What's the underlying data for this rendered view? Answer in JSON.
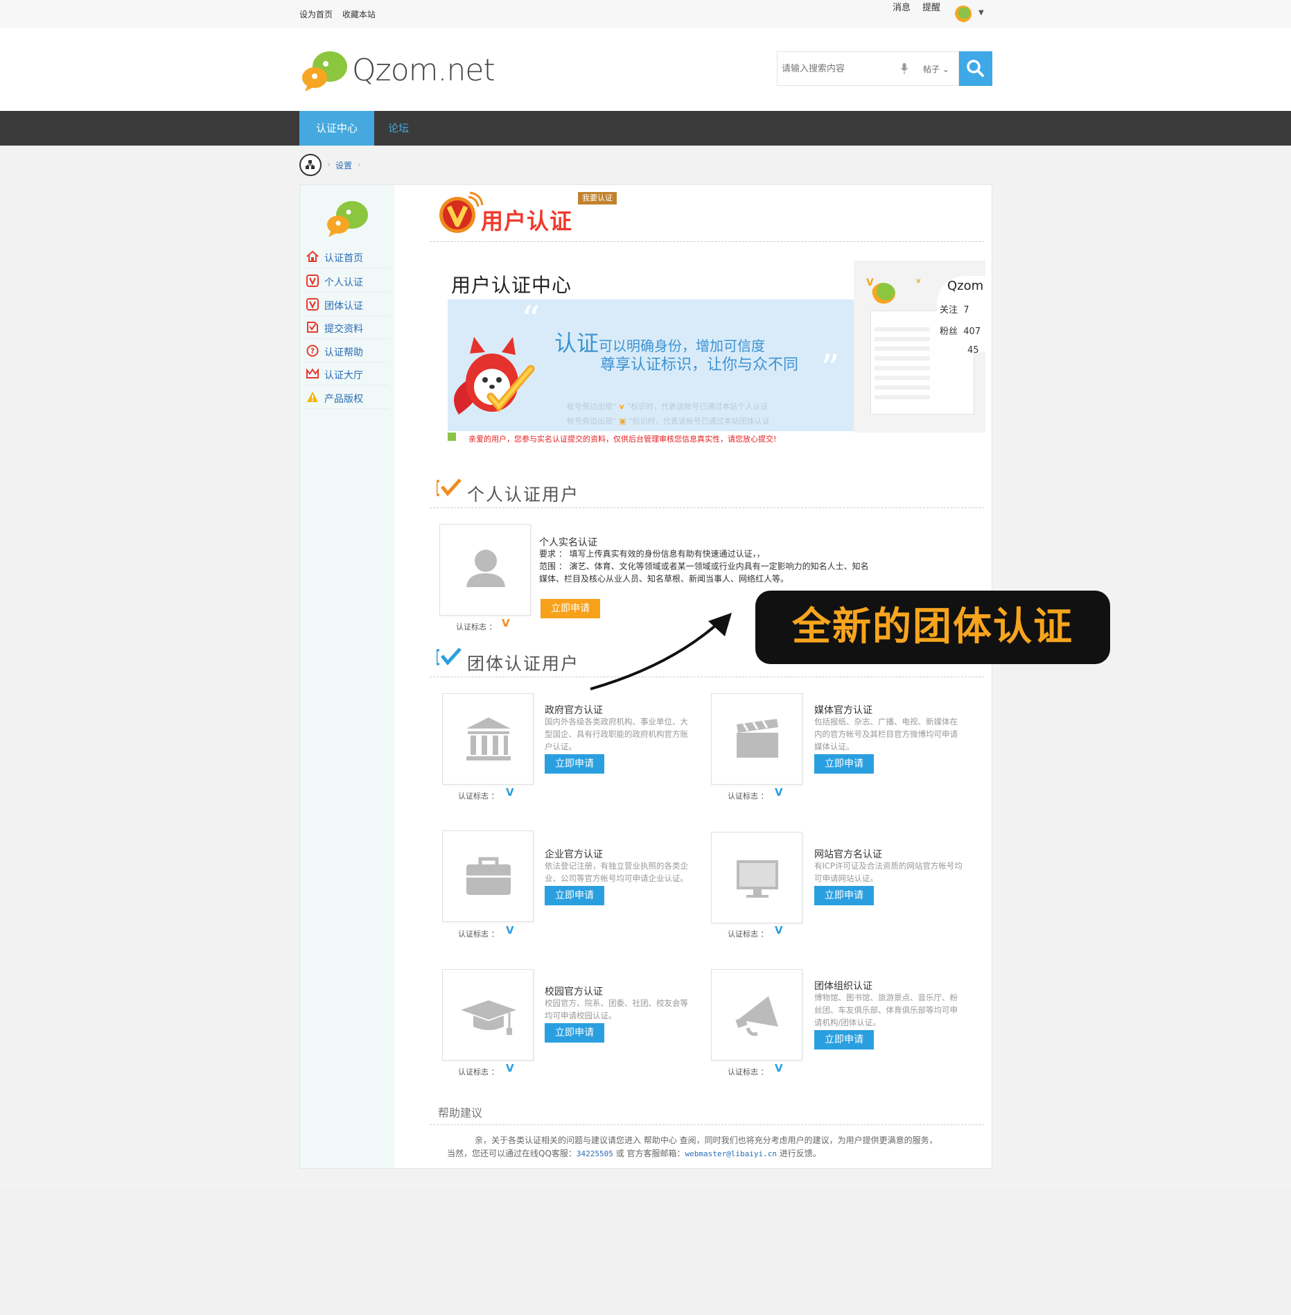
{
  "topbar": {
    "set_home": "设为首页",
    "bookmark": "收藏本站",
    "messages": "消息",
    "reminders": "提醒"
  },
  "header": {
    "logo_text": "Qzom.net",
    "search_placeholder": "请输入搜索内容",
    "search_type": "帖子"
  },
  "nav": {
    "items": [
      {
        "label": "认证中心",
        "active": true
      },
      {
        "label": "论坛",
        "active": false
      }
    ]
  },
  "breadcrumb": {
    "current": "设置"
  },
  "sidebar": {
    "items": [
      {
        "label": "认证首页",
        "icon": "home-icon"
      },
      {
        "label": "个人认证",
        "icon": "v-badge-icon"
      },
      {
        "label": "团体认证",
        "icon": "v-badge-icon"
      },
      {
        "label": "提交资料",
        "icon": "submit-icon"
      },
      {
        "label": "认证帮助",
        "icon": "help-icon"
      },
      {
        "label": "认证大厅",
        "icon": "crown-icon"
      },
      {
        "label": "产品版权",
        "icon": "warning-icon"
      }
    ]
  },
  "main": {
    "title": "用户认证",
    "apply_badge": "我要认证",
    "banner": {
      "title": "用户认证中心",
      "slogan_big": "认证",
      "slogan_rest": "可以明确身份，增加可信度",
      "slogan_line2": "尊享认证标识，让你与众不同",
      "note1_a": "帐号旁边出现“",
      "note1_b": "”标识时，代表该帐号已通过本站个人认证",
      "note2_a": "帐号旁边出现“",
      "note2_b": "”标识时，代表该帐号已通过本站团体认证",
      "profile_name": "Qzom",
      "stats": [
        {
          "label": "关注",
          "value": "7"
        },
        {
          "label": "粉丝",
          "value": "407"
        },
        {
          "label": "",
          "value": "45"
        }
      ]
    },
    "warning": "亲爱的用户，您参与实名认证提交的资料，仅供后台管理审核您信息真实性，请您放心提交!",
    "personal_section": "个人认证用户",
    "personal_card": {
      "title": "个人实名认证",
      "req": "要求 ： 填写上传真实有效的身份信息有助有快速通过认证，，",
      "scope1": "范围 ： 演艺、体育、文化等领域或者某一领域或行业内具有一定影响力的知名人士、知名",
      "scope2": "媒体、栏目及核心从业人员、知名草根、新闻当事人、网络红人等。",
      "mark_label": "认证标志 ：",
      "button": "立即申请"
    },
    "group_section": "团体认证用户",
    "group_cards": [
      {
        "title": "政府官方认证",
        "desc": [
          "国内外各级各类政府机构、事业单位、大",
          "型国企、具有行政职能的政府机构官方账",
          "户认证。"
        ],
        "icon": "government-building-icon"
      },
      {
        "title": "媒体官方认证",
        "desc": [
          "包括报纸、杂志、广播、电视、新媒体在",
          "内的官方帐号及其栏目官方微博均可申请",
          "媒体认证。"
        ],
        "icon": "clapperboard-icon"
      },
      {
        "title": "企业官方认证",
        "desc": [
          "依法登记注册，有独立营业执照的各类企",
          "业、公司等官方帐号均可申请企业认证。"
        ],
        "icon": "briefcase-icon"
      },
      {
        "title": "网站官方名认证",
        "desc": [
          "有ICP许可证及合法资质的网站官方帐号均",
          "可申请网站认证。"
        ],
        "icon": "monitor-icon"
      },
      {
        "title": "校园官方认证",
        "desc": [
          "校园官方、院系、团委、社团、校友会等",
          "均可申请校园认证。"
        ],
        "icon": "graduation-cap-icon"
      },
      {
        "title": "团体组织认证",
        "desc": [
          "博物馆、图书馆、旅游景点、音乐厅、粉",
          "丝团、车友俱乐部、体育俱乐部等均可申",
          "请机构/团体认证。"
        ],
        "icon": "megaphone-icon"
      }
    ],
    "group_mark_label": "认证标志 ：",
    "group_button": "立即申请"
  },
  "help": {
    "title": "帮助建议",
    "line1": "亲，关于各类认证相关的问题与建议请您进入 帮助中心 查阅，同时我们也将充分考虑用户的建议，为用户提供更满意的服务，",
    "line2_a": "当然，您还可以通过在线QQ客服：",
    "qq": "34225505",
    "line2_b": " 或 官方客服邮箱：",
    "email": "webmaster@libaiyi.cn",
    "line2_c": " 进行反馈。"
  },
  "callout": {
    "text": "全新的团体认证"
  },
  "colors": {
    "accent_blue": "#45a9df",
    "button_blue": "#2a9fe0",
    "button_orange": "#f7a11a",
    "title_red": "#ef3a2c",
    "nav_dark": "#3b3b3b",
    "callout_orange": "#f7a41e"
  }
}
